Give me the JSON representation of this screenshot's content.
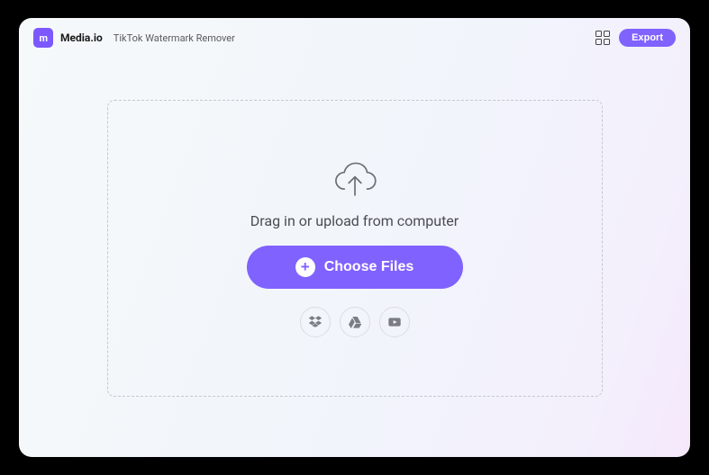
{
  "header": {
    "logo_text": "m",
    "brand": "Media.io",
    "title": "TikTok Watermark Remover",
    "export_label": "Export"
  },
  "dropzone": {
    "text": "Drag in or upload from computer",
    "choose_label": "Choose Files"
  }
}
